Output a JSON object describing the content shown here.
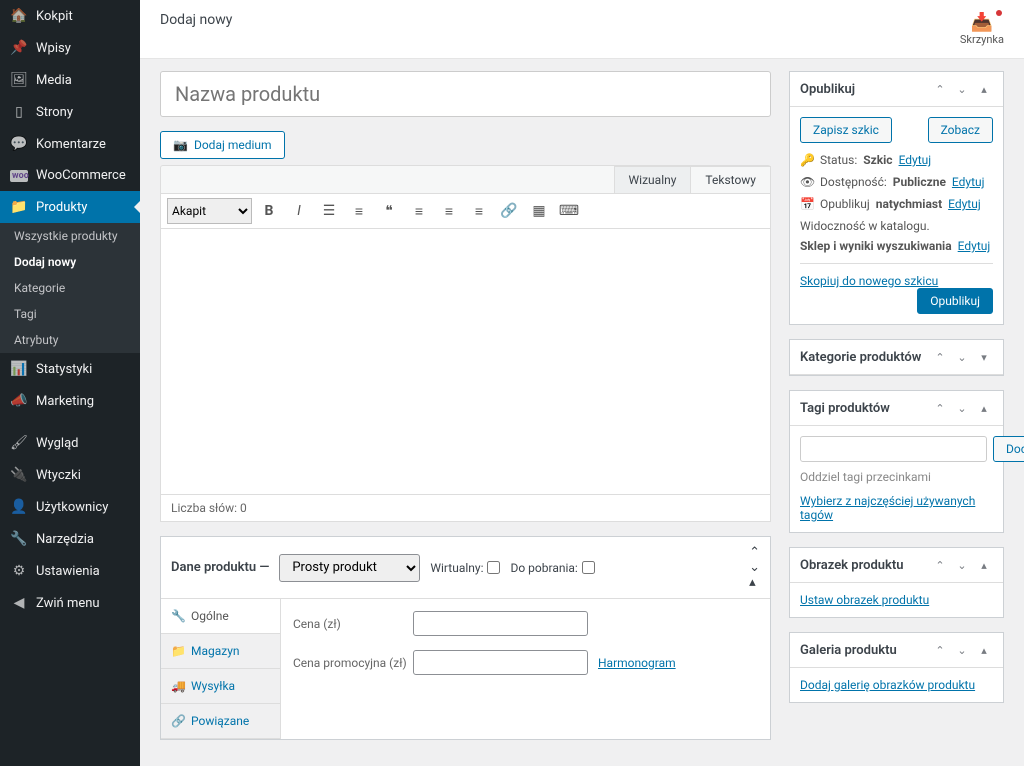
{
  "sidebar": {
    "items": [
      {
        "icon": "speed",
        "label": "Kokpit"
      },
      {
        "icon": "pin",
        "label": "Wpisy"
      },
      {
        "icon": "media",
        "label": "Media"
      },
      {
        "icon": "page",
        "label": "Strony"
      },
      {
        "icon": "comment",
        "label": "Komentarze"
      },
      {
        "icon": "woo",
        "label": "WooCommerce"
      },
      {
        "icon": "folder",
        "label": "Produkty"
      },
      {
        "icon": "stats",
        "label": "Statystyki"
      },
      {
        "icon": "marketing",
        "label": "Marketing"
      },
      {
        "icon": "brush",
        "label": "Wygląd"
      },
      {
        "icon": "plug",
        "label": "Wtyczki"
      },
      {
        "icon": "user",
        "label": "Użytkownicy"
      },
      {
        "icon": "wrench",
        "label": "Narzędzia"
      },
      {
        "icon": "settings",
        "label": "Ustawienia"
      },
      {
        "icon": "collapse",
        "label": "Zwiń menu"
      }
    ],
    "active_index": 6,
    "submenu": [
      "Wszystkie produkty",
      "Dodaj nowy",
      "Kategorie",
      "Tagi",
      "Atrybuty"
    ],
    "submenu_current": 1
  },
  "topbar": {
    "title": "Dodaj nowy",
    "inbox": "Skrzynka"
  },
  "editor": {
    "title_placeholder": "Nazwa produktu",
    "add_media": "Dodaj medium",
    "tabs": {
      "visual": "Wizualny",
      "text": "Tekstowy"
    },
    "format_select": "Akapit",
    "wordcount": "Liczba słów: 0"
  },
  "publish": {
    "title": "Opublikuj",
    "save_draft": "Zapisz szkic",
    "preview": "Zobacz",
    "status_label": "Status:",
    "status_value": "Szkic",
    "visibility_label": "Dostępność:",
    "visibility_value": "Publiczne",
    "publish_label": "Opublikuj",
    "publish_value": "natychmiast",
    "catalog_label": "Widoczność w katalogu.",
    "catalog_value": "Sklep i wyniki wyszukiwania",
    "edit": "Edytuj",
    "copy_draft": "Skopiuj do nowego szkicu",
    "publish_btn": "Opublikuj"
  },
  "categories": {
    "title": "Kategorie produktów"
  },
  "tags": {
    "title": "Tagi produktów",
    "add": "Dodaj",
    "hint": "Oddziel tagi przecinkami",
    "choose": "Wybierz z najczęściej używanych tagów"
  },
  "image": {
    "title": "Obrazek produktu",
    "set": "Ustaw obrazek produktu"
  },
  "gallery": {
    "title": "Galeria produktu",
    "add": "Dodaj galerię obrazków produktu"
  },
  "product_data": {
    "title": "Dane produktu —",
    "type": "Prosty produkt",
    "virtual": "Wirtualny:",
    "downloadable": "Do pobrania:",
    "tabs": [
      {
        "icon": "wrench",
        "label": "Ogólne"
      },
      {
        "icon": "folder",
        "label": "Magazyn"
      },
      {
        "icon": "truck",
        "label": "Wysyłka"
      },
      {
        "icon": "link",
        "label": "Powiązane"
      }
    ],
    "price_label": "Cena (zł)",
    "sale_price_label": "Cena promocyjna (zł)",
    "schedule": "Harmonogram"
  }
}
